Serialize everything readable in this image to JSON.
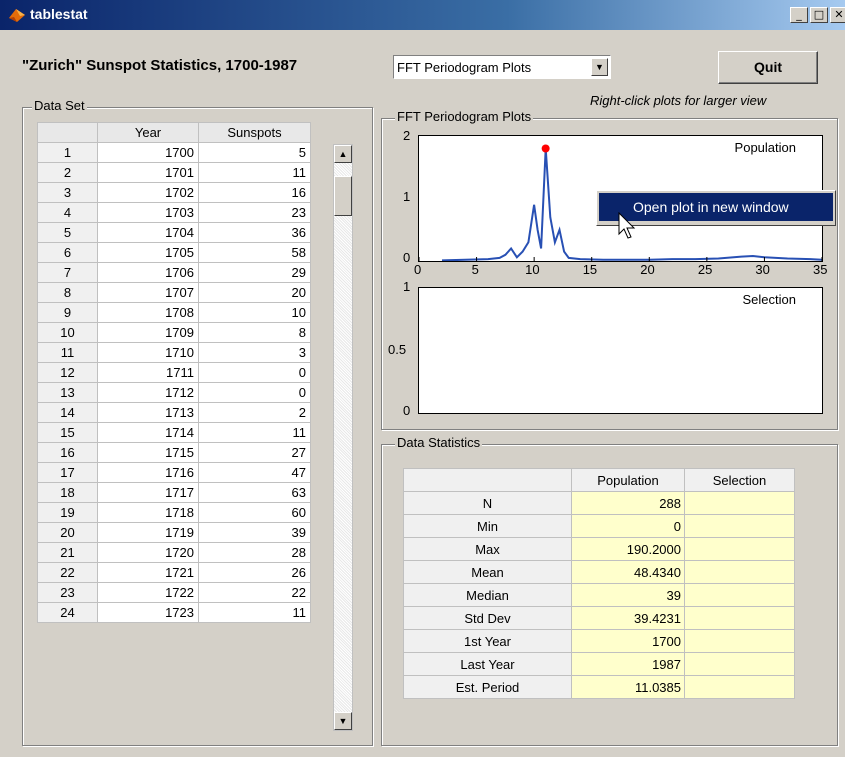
{
  "window": {
    "title": "tablestat",
    "controls": [
      "_",
      "□",
      "✕"
    ]
  },
  "header": {
    "title": "\"Zurich\"  Sunspot Statistics, 1700-1987",
    "plot_select": "FFT Periodogram Plots",
    "quit_label": "Quit",
    "hint": "Right-click plots for larger view"
  },
  "data_set": {
    "label": "Data Set",
    "columns": [
      "",
      "Year",
      "Sunspots"
    ],
    "rows": [
      [
        "1",
        "1700",
        "5"
      ],
      [
        "2",
        "1701",
        "11"
      ],
      [
        "3",
        "1702",
        "16"
      ],
      [
        "4",
        "1703",
        "23"
      ],
      [
        "5",
        "1704",
        "36"
      ],
      [
        "6",
        "1705",
        "58"
      ],
      [
        "7",
        "1706",
        "29"
      ],
      [
        "8",
        "1707",
        "20"
      ],
      [
        "9",
        "1708",
        "10"
      ],
      [
        "10",
        "1709",
        "8"
      ],
      [
        "11",
        "1710",
        "3"
      ],
      [
        "12",
        "1711",
        "0"
      ],
      [
        "13",
        "1712",
        "0"
      ],
      [
        "14",
        "1713",
        "2"
      ],
      [
        "15",
        "1714",
        "11"
      ],
      [
        "16",
        "1715",
        "27"
      ],
      [
        "17",
        "1716",
        "47"
      ],
      [
        "18",
        "1717",
        "63"
      ],
      [
        "19",
        "1718",
        "60"
      ],
      [
        "20",
        "1719",
        "39"
      ],
      [
        "21",
        "1720",
        "28"
      ],
      [
        "22",
        "1721",
        "26"
      ],
      [
        "23",
        "1722",
        "22"
      ],
      [
        "24",
        "1723",
        "11"
      ]
    ]
  },
  "plots": {
    "label": "FFT Periodogram Plots",
    "population": {
      "label": "Population",
      "yticks": [
        "2",
        "1",
        "0"
      ],
      "xticks": [
        "0",
        "5",
        "10",
        "15",
        "20",
        "25",
        "30",
        "35"
      ]
    },
    "selection": {
      "label": "Selection",
      "yticks": [
        "1",
        "0.5",
        "0"
      ]
    }
  },
  "chart_data": {
    "type": "line",
    "title": "",
    "xlabel": "",
    "ylabel": "",
    "xlim": [
      0,
      35
    ],
    "ylim": [
      0,
      2
    ],
    "series": [
      {
        "x": [
          2,
          4,
          6,
          7,
          7.5,
          8,
          8.5,
          9,
          9.5,
          10,
          10.3,
          10.6,
          11,
          11.4,
          11.8,
          12.2,
          12.6,
          13,
          14,
          16,
          18,
          20,
          22,
          24,
          26,
          28,
          29,
          30,
          32,
          34,
          35
        ],
        "y": [
          0.01,
          0.02,
          0.03,
          0.05,
          0.1,
          0.2,
          0.06,
          0.15,
          0.3,
          0.9,
          0.5,
          0.2,
          1.8,
          0.7,
          0.3,
          0.5,
          0.15,
          0.05,
          0.03,
          0.02,
          0.02,
          0.02,
          0.03,
          0.03,
          0.04,
          0.07,
          0.08,
          0.06,
          0.04,
          0.03,
          0.02
        ]
      }
    ],
    "peak": {
      "x": 11,
      "y": 1.8,
      "color": "#ff0000"
    },
    "line_color": "#2850b4"
  },
  "statistics": {
    "label": "Data Statistics",
    "columns": [
      "",
      "Population",
      "Selection"
    ],
    "rows": [
      [
        "N",
        "288",
        ""
      ],
      [
        "Min",
        "0",
        ""
      ],
      [
        "Max",
        "190.2000",
        ""
      ],
      [
        "Mean",
        "48.4340",
        ""
      ],
      [
        "Median",
        "39",
        ""
      ],
      [
        "Std Dev",
        "39.4231",
        ""
      ],
      [
        "1st Year",
        "1700",
        ""
      ],
      [
        "Last Year",
        "1987",
        ""
      ],
      [
        "Est. Period",
        "11.0385",
        ""
      ]
    ]
  },
  "context_menu": {
    "item": "Open plot in new window"
  }
}
